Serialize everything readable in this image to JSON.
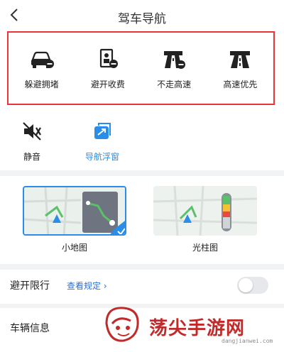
{
  "header": {
    "title": "驾车导航"
  },
  "route_prefs": [
    {
      "label": "躲避拥堵",
      "icon": "car-avoid-congestion-icon"
    },
    {
      "label": "避开收费",
      "icon": "avoid-toll-icon"
    },
    {
      "label": "不走高速",
      "icon": "no-highway-icon"
    },
    {
      "label": "高速优先",
      "icon": "highway-first-icon"
    }
  ],
  "tools": [
    {
      "label": "静音",
      "icon": "mute-icon"
    },
    {
      "label": "导航浮窗",
      "icon": "floating-window-icon"
    }
  ],
  "map_modes": [
    {
      "label": "小地图",
      "selected": true
    },
    {
      "label": "光柱图",
      "selected": false
    }
  ],
  "restriction": {
    "label": "避开限行",
    "link": "查看规定",
    "toggle_on": false
  },
  "vehicle": {
    "label": "车辆信息"
  },
  "watermark": {
    "brand": "荡尖手游网",
    "url": "dangjianwei.com"
  },
  "colors": {
    "accent": "#2a8ee8",
    "highlight_border": "#e8343b",
    "link": "#2a6fd6",
    "watermark": "#c22a2a"
  }
}
